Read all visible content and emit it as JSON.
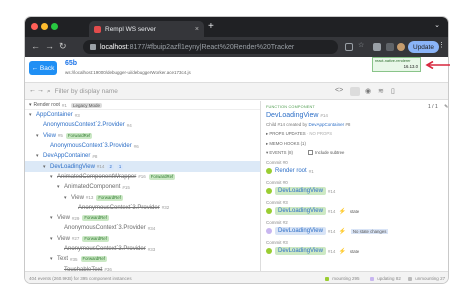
{
  "browser": {
    "tab_title": "Rempl WS server",
    "tab_close": "×",
    "new_tab": "+",
    "tab_menu": "⌄",
    "url_host": "localhost",
    "url_rest": ":8177/#fbuip2azfl1eyny|React%20Render%20Tracker",
    "update_label": "Update",
    "more_menu": "⋮"
  },
  "app": {
    "back_label": "← Back",
    "title": "65b",
    "subtitle": "ws://localhost:19000/debugger-ui/debuggerWorker.ace173c4.js"
  },
  "toolbar": {
    "search_placeholder": "Filter by display name"
  },
  "version_badge": {
    "label": "react-native-renderer",
    "version": "16.13.0"
  },
  "tree": {
    "head": "Render root",
    "head_key": "#1",
    "legacy": "Legacy Mode",
    "rows": [
      {
        "indent": 0,
        "arrow": "▾",
        "name": "AppContainer",
        "key": "#3",
        "style": "blue",
        "badges": []
      },
      {
        "indent": 1,
        "arrow": "",
        "name": "AnonymousContext`2.Provider",
        "key": "#4",
        "style": "blue",
        "badges": []
      },
      {
        "indent": 1,
        "arrow": "▾",
        "name": "View",
        "key": "#5",
        "style": "blue",
        "badges": [
          {
            "t": "ForwardRef",
            "c": "fwd"
          }
        ]
      },
      {
        "indent": 2,
        "arrow": "",
        "name": "AnonymousContext`3.Provider",
        "key": "#6",
        "style": "blue",
        "badges": []
      },
      {
        "indent": 1,
        "arrow": "▾",
        "name": "DevAppContainer",
        "key": "#8",
        "style": "blue",
        "badges": []
      },
      {
        "indent": 2,
        "arrow": "▾",
        "name": "DevLoadingView",
        "key": "#14",
        "style": "blue",
        "badges": [
          {
            "t": "2",
            "c": "blue"
          },
          {
            "t": "1",
            "c": "blue"
          }
        ],
        "selected": true
      },
      {
        "indent": 3,
        "arrow": "▾",
        "name": "AnimatedComponentWrapper",
        "key": "#16",
        "style": "strike",
        "badges": [
          {
            "t": "ForwardRef",
            "c": "fwd"
          }
        ]
      },
      {
        "indent": 4,
        "arrow": "▾",
        "name": "AnimatedComponent",
        "key": "#15",
        "style": "grey",
        "badges": []
      },
      {
        "indent": 5,
        "arrow": "▾",
        "name": "View",
        "key": "#13",
        "style": "grey",
        "badges": [
          {
            "t": "ForwardRef",
            "c": "fwd"
          }
        ]
      },
      {
        "indent": 6,
        "arrow": "",
        "name": "AnonymousContext`3.Provider",
        "key": "#32",
        "style": "strike",
        "badges": []
      },
      {
        "indent": 3,
        "arrow": "▾",
        "name": "View",
        "key": "#29",
        "style": "grey",
        "badges": [
          {
            "t": "ForwardRef",
            "c": "fwd"
          }
        ]
      },
      {
        "indent": 4,
        "arrow": "",
        "name": "AnonymousContext`3.Provider",
        "key": "#34",
        "style": "grey",
        "badges": []
      },
      {
        "indent": 3,
        "arrow": "▾",
        "name": "View",
        "key": "#27",
        "style": "grey",
        "badges": [
          {
            "t": "ForwardRef",
            "c": "fwd"
          }
        ]
      },
      {
        "indent": 4,
        "arrow": "",
        "name": "AnonymousContext`3.Provider",
        "key": "#33",
        "style": "strike",
        "badges": []
      },
      {
        "indent": 3,
        "arrow": "▾",
        "name": "Text",
        "key": "#35",
        "style": "grey",
        "badges": [
          {
            "t": "ForwardRef",
            "c": "fwd"
          }
        ]
      },
      {
        "indent": 4,
        "arrow": "",
        "name": "TouchableText",
        "key": "#36",
        "style": "strike",
        "badges": []
      }
    ]
  },
  "panel": {
    "tag": "FUNCTION COMPONENT",
    "name": "DevLoadingView",
    "key": "#14",
    "created_prefix": "Child #14 created by",
    "created_by": "DevAppContainer",
    "created_key": "#8",
    "props_label": "▸ PROPS UPDATES",
    "props_muted": "· NO PROPS",
    "memo_label": "▸ MEMO HOOKS (1)",
    "events_label": "▾ EVENTS (8)",
    "includes_label": "Include subtree",
    "page": "1 / 1",
    "events": [
      {
        "commit": "Commit #0",
        "kind": "link",
        "text": "Render root",
        "key": "#1"
      },
      {
        "commit": "Commit #0",
        "kind": "green",
        "text": "DevLoadingView",
        "key": "#14"
      },
      {
        "commit": "Commit #3",
        "kind": "green",
        "text": "DevLoadingView",
        "key": "#14",
        "extra": "state"
      },
      {
        "commit": "Commit #2",
        "kind": "blue",
        "text": "DevLoadingView",
        "key": "#14",
        "extra": "No state changes",
        "extraChip": true
      },
      {
        "commit": "Commit #3",
        "kind": "green",
        "text": "DevLoadingView",
        "key": "#14",
        "extra": "state"
      }
    ]
  },
  "status": {
    "left": "404 events (260.9KB) for 395 component instances",
    "mounted_label": "mounting",
    "mounted_val": "295",
    "updated_label": "updating",
    "updated_val": "82",
    "unmounted_label": "unmounting",
    "unmounted_val": "27"
  },
  "colors": {
    "accent": "#1f8ff4",
    "link": "#2d6fc7",
    "forward_ref_bg": "#cbe8c5",
    "arrow_red": "#d7263d"
  }
}
